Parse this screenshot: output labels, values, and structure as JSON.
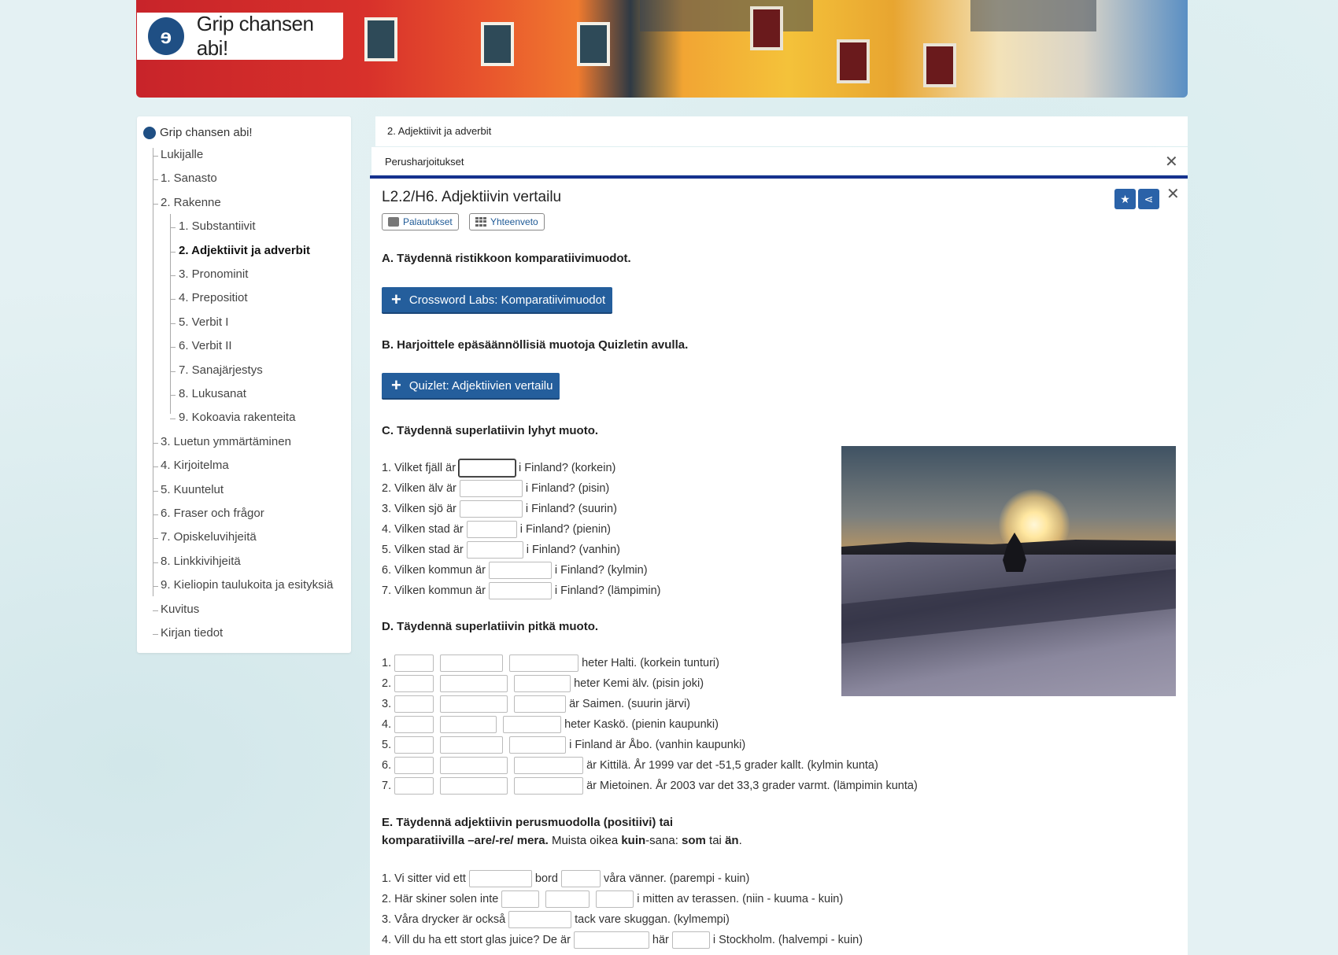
{
  "header": {
    "logo_text": "Grip chansen abi!"
  },
  "sidebar": {
    "root": "Grip chansen abi!",
    "items": [
      {
        "label": "Lukijalle",
        "level": 1
      },
      {
        "label": "1. Sanasto",
        "level": 1
      },
      {
        "label": "2. Rakenne",
        "level": 1
      },
      {
        "label": "1. Substantiivit",
        "level": 2
      },
      {
        "label": "2. Adjektiivit ja adverbit",
        "level": 2,
        "active": true
      },
      {
        "label": "3. Pronominit",
        "level": 2
      },
      {
        "label": "4. Prepositiot",
        "level": 2
      },
      {
        "label": "5. Verbit I",
        "level": 2
      },
      {
        "label": "6. Verbit II",
        "level": 2
      },
      {
        "label": "7. Sanajärjestys",
        "level": 2
      },
      {
        "label": "8. Lukusanat",
        "level": 2
      },
      {
        "label": "9. Kokoavia rakenteita",
        "level": 2
      },
      {
        "label": "3. Luetun ymmärtäminen",
        "level": 1
      },
      {
        "label": "4. Kirjoitelma",
        "level": 1
      },
      {
        "label": "5. Kuuntelut",
        "level": 1
      },
      {
        "label": "6. Fraser och frågor",
        "level": 1
      },
      {
        "label": "7. Opiskeluvihjeitä",
        "level": 1
      },
      {
        "label": "8. Linkkivihjeitä",
        "level": 1
      },
      {
        "label": "9. Kieliopin taulukoita ja esityksiä",
        "level": 1
      },
      {
        "label": "Kuvitus",
        "level": 1
      },
      {
        "label": "Kirjan tiedot",
        "level": 1
      }
    ]
  },
  "breadcrumb": "2. Adjektiivit ja adverbit",
  "subpanel": {
    "title": "Perusharjoitukset"
  },
  "page": {
    "title": "L2.2/H6. Adjektiivin vertailu",
    "pill_returns": "Palautukset",
    "pill_summary": "Yhteenveto",
    "section_a": "A. Täydennä ristikkoon komparatiivimuodot.",
    "btn_a": "Crossword Labs: Komparatiivimuodot",
    "section_b": "B. Harjoittele epäsäännöllisiä muotoja Quizletin avulla.",
    "btn_b": "Quizlet: Adjektiivien vertailu",
    "section_c": "C. Täydennä superlatiivin lyhyt muoto.",
    "section_d": "D. Täydennä superlatiivin pitkä muoto.",
    "section_e_line1": "E. Täydennä adjektiivin perusmuodolla (positiivi) tai",
    "section_e_line2_bold": "komparatiivilla –are/-re/ mera.",
    "section_e_line2_a": " Muista oikea ",
    "section_e_line2_kuin": "kuin",
    "section_e_line2_b": "-sana: ",
    "section_e_line2_som": "som",
    "section_e_line2_c": " tai ",
    "section_e_line2_an": "än",
    "section_e_line2_d": "."
  },
  "c_lines": [
    {
      "pre": "1. Vilket fjäll är",
      "post": "i Finland? (korkein)"
    },
    {
      "pre": "2. Vilken älv är",
      "post": "i Finland? (pisin)"
    },
    {
      "pre": "3. Vilken sjö är",
      "post": "i Finland? (suurin)"
    },
    {
      "pre": "4. Vilken stad är",
      "post": "i Finland? (pienin)"
    },
    {
      "pre": "5. Vilken stad är",
      "post": "i Finland? (vanhin)"
    },
    {
      "pre": "6. Vilken kommun är",
      "post": "i Finland? (kylmin)"
    },
    {
      "pre": "7. Vilken kommun är",
      "post": "i Finland? (lämpimin)"
    }
  ],
  "d_lines": [
    {
      "num": "1.",
      "post": "heter Halti. (korkein tunturi)"
    },
    {
      "num": "2.",
      "post": "heter Kemi älv. (pisin joki)"
    },
    {
      "num": "3.",
      "post": "är Saimen. (suurin järvi)"
    },
    {
      "num": "4.",
      "post": "heter Kaskö. (pienin kaupunki)"
    },
    {
      "num": "5.",
      "post": "i Finland är Åbo. (vanhin kaupunki)"
    },
    {
      "num": "6.",
      "post": "är Kittilä. År 1999 var det -51,5 grader kallt. (kylmin kunta)"
    },
    {
      "num": "7.",
      "post": "är Mietoinen. År 2003 var det 33,3 grader varmt. (lämpimin kunta)"
    }
  ],
  "e_lines": [
    {
      "a": "1. Vi sitter vid ett",
      "b": "bord",
      "c": "våra vänner. (parempi - kuin)"
    },
    {
      "a": "2. Här skiner solen inte",
      "c": "i mitten av terassen. (niin - kuuma - kuin)"
    },
    {
      "a": "3. Våra drycker är också",
      "c": "tack vare skuggan. (kylmempi)"
    },
    {
      "a": "4. Vill du ha ett stort glas juice? De är",
      "b": "här",
      "c": "i Stockholm. (halvempi - kuin)"
    }
  ],
  "colors": {
    "brand_blue": "#245e9c",
    "accent_line": "#16328e"
  }
}
